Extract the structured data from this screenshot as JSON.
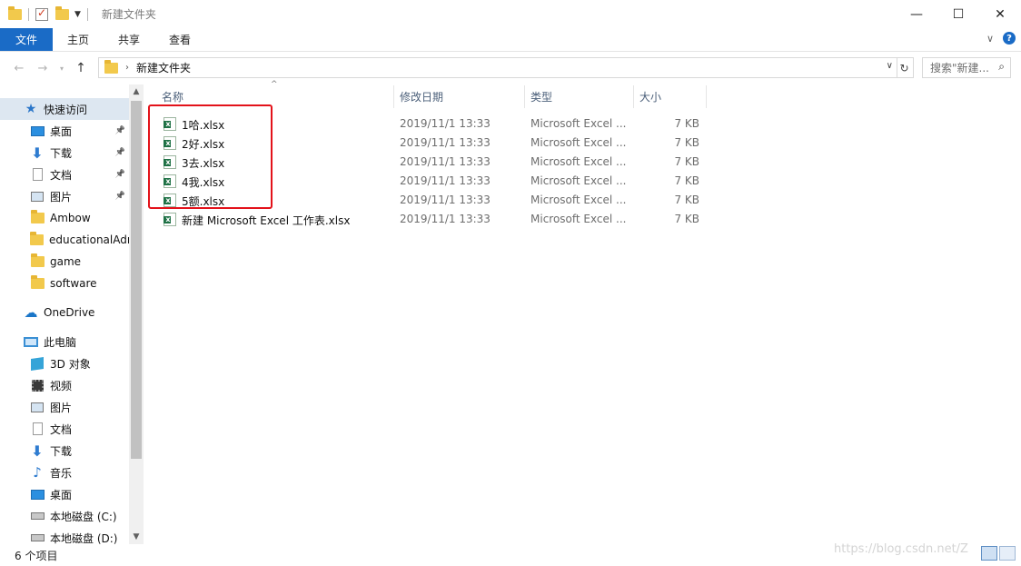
{
  "window": {
    "title": "新建文件夹"
  },
  "ribbon": {
    "tabs": [
      "文件",
      "主页",
      "共享",
      "查看"
    ]
  },
  "address": {
    "path": "新建文件夹",
    "search_placeholder": "搜索\"新建..."
  },
  "sidebar": {
    "items": [
      {
        "label": "快速访问",
        "icon": "star-icon",
        "pinned": false,
        "active": true,
        "indent": 0
      },
      {
        "label": "桌面",
        "icon": "desktop-icon",
        "pinned": true,
        "indent": 1
      },
      {
        "label": "下载",
        "icon": "download-icon",
        "pinned": true,
        "indent": 1
      },
      {
        "label": "文档",
        "icon": "document-icon",
        "pinned": true,
        "indent": 1
      },
      {
        "label": "图片",
        "icon": "picture-icon",
        "pinned": true,
        "indent": 1
      },
      {
        "label": "Ambow",
        "icon": "folder-icon",
        "pinned": false,
        "indent": 1
      },
      {
        "label": "educationalAdr",
        "icon": "folder-icon",
        "pinned": false,
        "indent": 1
      },
      {
        "label": "game",
        "icon": "folder-icon",
        "pinned": false,
        "indent": 1
      },
      {
        "label": "software",
        "icon": "folder-icon",
        "pinned": false,
        "indent": 1
      },
      {
        "label": "OneDrive",
        "icon": "cloud-icon",
        "pinned": false,
        "indent": 0
      },
      {
        "label": "此电脑",
        "icon": "pc-icon",
        "pinned": false,
        "indent": 0
      },
      {
        "label": "3D 对象",
        "icon": "3d-objects-icon",
        "pinned": false,
        "indent": 1
      },
      {
        "label": "视频",
        "icon": "video-icon",
        "pinned": false,
        "indent": 1
      },
      {
        "label": "图片",
        "icon": "picture-icon",
        "pinned": false,
        "indent": 1
      },
      {
        "label": "文档",
        "icon": "document-icon",
        "pinned": false,
        "indent": 1
      },
      {
        "label": "下载",
        "icon": "download-icon",
        "pinned": false,
        "indent": 1
      },
      {
        "label": "音乐",
        "icon": "music-icon",
        "pinned": false,
        "indent": 1
      },
      {
        "label": "桌面",
        "icon": "desktop-icon",
        "pinned": false,
        "indent": 1
      },
      {
        "label": "本地磁盘 (C:)",
        "icon": "drive-icon",
        "pinned": false,
        "indent": 1
      },
      {
        "label": "本地磁盘 (D:)",
        "icon": "drive-icon",
        "pinned": false,
        "indent": 1
      }
    ]
  },
  "columns": [
    "名称",
    "修改日期",
    "类型",
    "大小"
  ],
  "files": [
    {
      "name": "1哈.xlsx",
      "date": "2019/11/1 13:33",
      "type": "Microsoft Excel ...",
      "size": "7 KB"
    },
    {
      "name": "2好.xlsx",
      "date": "2019/11/1 13:33",
      "type": "Microsoft Excel ...",
      "size": "7 KB"
    },
    {
      "name": "3去.xlsx",
      "date": "2019/11/1 13:33",
      "type": "Microsoft Excel ...",
      "size": "7 KB"
    },
    {
      "name": "4我.xlsx",
      "date": "2019/11/1 13:33",
      "type": "Microsoft Excel ...",
      "size": "7 KB"
    },
    {
      "name": "5额.xlsx",
      "date": "2019/11/1 13:33",
      "type": "Microsoft Excel ...",
      "size": "7 KB"
    },
    {
      "name": "新建 Microsoft Excel 工作表.xlsx",
      "date": "2019/11/1 13:33",
      "type": "Microsoft Excel ...",
      "size": "7 KB"
    }
  ],
  "status": {
    "item_count": "6 个项目"
  },
  "watermark": "https://blog.csdn.net/Z",
  "colors": {
    "accent": "#1a6bc6",
    "highlight_box": "#e3121a"
  }
}
